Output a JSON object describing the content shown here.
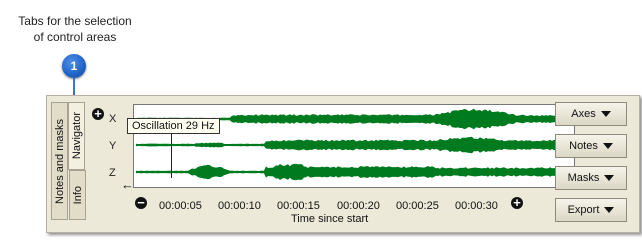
{
  "callout": {
    "text_line1": "Tabs for the selection",
    "text_line2": "of control areas",
    "badge_number": "1",
    "badge_color": "#1f62c8"
  },
  "tabs": [
    {
      "label": "Notes and masks",
      "active": false
    },
    {
      "label": "Info",
      "active": false
    },
    {
      "label": "Navigator",
      "active": true
    }
  ],
  "plot": {
    "channels": [
      "X",
      "Y",
      "Z"
    ],
    "tooltip": "Oscillation 29 Hz",
    "waveform_color": "#007a1e",
    "zoom_in_icon": "plus-circle-icon",
    "zoom_out_icon": "minus-circle-icon",
    "back_icon": "arrow-left-icon",
    "x_ticks": [
      "00:00:05",
      "00:00:10",
      "00:00:15",
      "00:00:20",
      "00:00:25",
      "00:00:30"
    ],
    "xlabel": "Time since start"
  },
  "buttons": [
    {
      "label": "Axes"
    },
    {
      "label": "Notes"
    },
    {
      "label": "Masks"
    },
    {
      "label": "Export"
    }
  ]
}
